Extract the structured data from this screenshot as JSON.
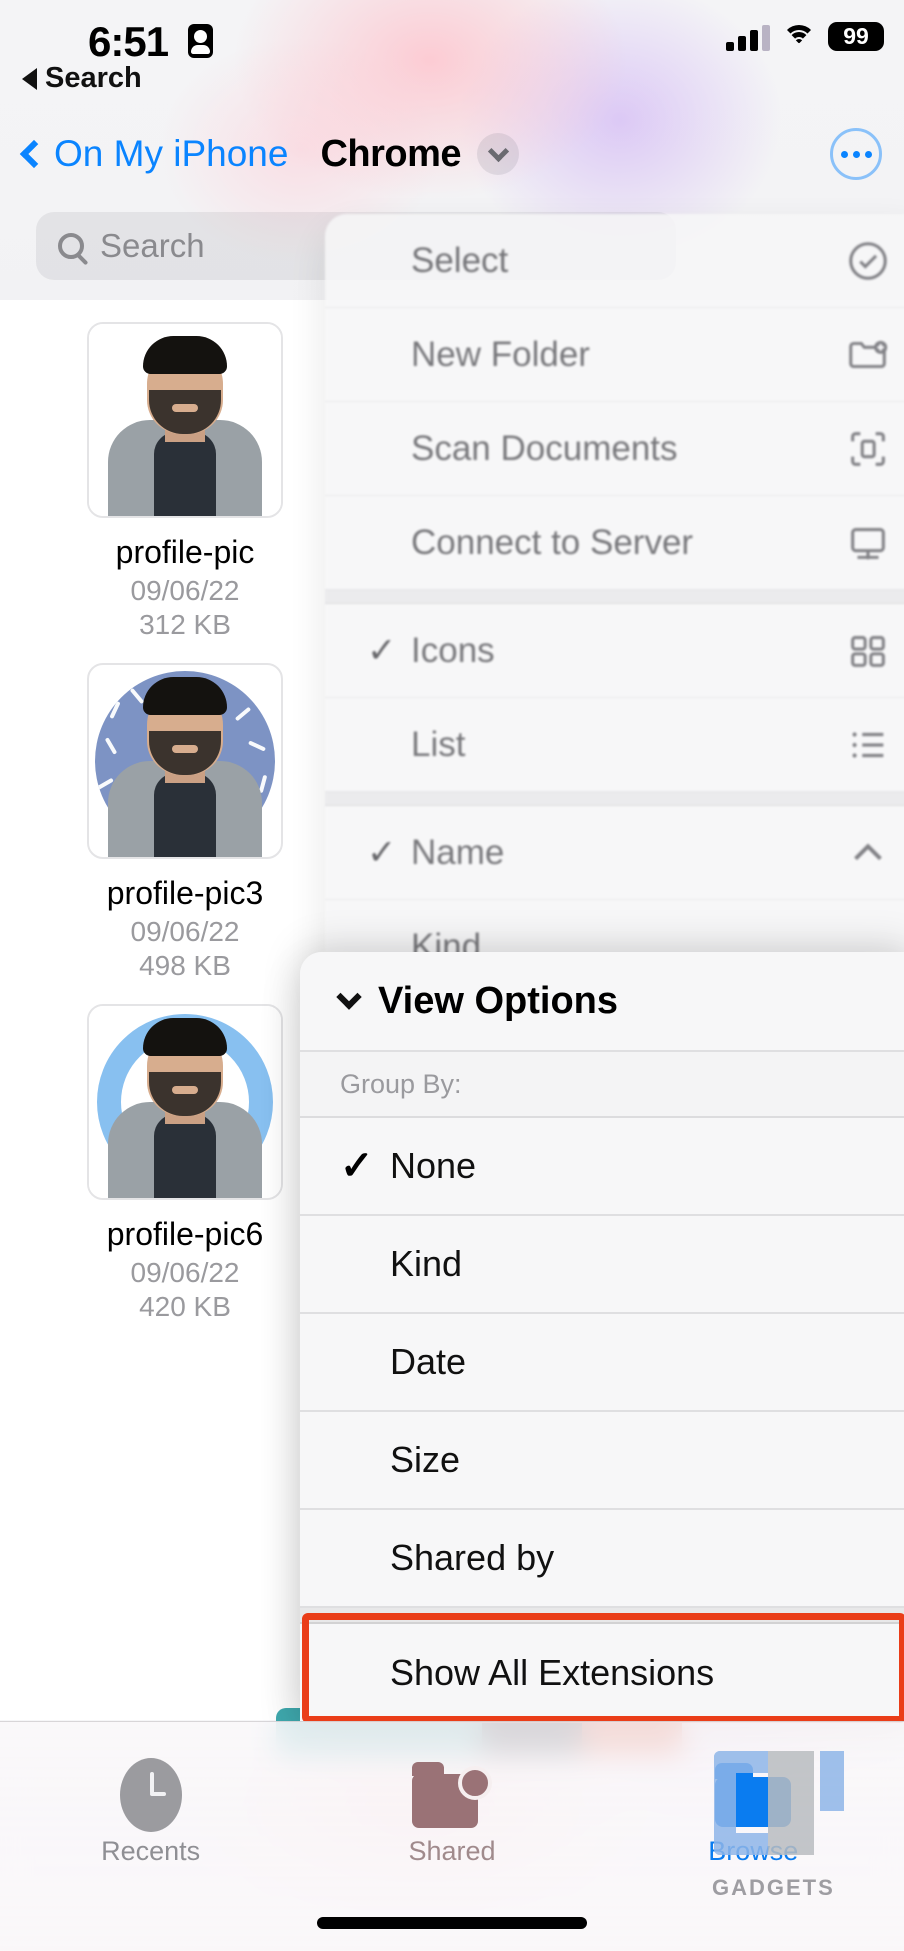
{
  "status_bar": {
    "time": "6:51",
    "recording_icon": "person-badge-icon",
    "back_label": "Search",
    "signal_icon": "cellular-bars-icon",
    "wifi_icon": "wifi-icon",
    "battery_level": "99"
  },
  "nav_bar": {
    "back_label": "On My iPhone",
    "title": "Chrome",
    "title_chevron_icon": "chevron-down-icon",
    "more_icon": "ellipsis-circle-icon"
  },
  "search": {
    "placeholder": "Search",
    "icon": "search-icon"
  },
  "files": [
    {
      "name": "profile-pic",
      "date": "09/06/22",
      "size": "312 KB",
      "thumb": "plain"
    },
    {
      "name": "profile-pic3",
      "date": "09/06/22",
      "size": "498 KB",
      "thumb": "dotted"
    },
    {
      "name": "profile-pic6",
      "date": "09/06/22",
      "size": "420 KB",
      "thumb": "ring"
    }
  ],
  "background_menu": {
    "groups": [
      {
        "items": [
          {
            "label": "Select",
            "icon": "checkmark-circle-icon",
            "checked": false
          },
          {
            "label": "New Folder",
            "icon": "folder-plus-icon",
            "checked": false
          },
          {
            "label": "Scan Documents",
            "icon": "scan-document-icon",
            "checked": false
          },
          {
            "label": "Connect to Server",
            "icon": "display-icon",
            "checked": false
          }
        ]
      },
      {
        "items": [
          {
            "label": "Icons",
            "icon": "grid-icon",
            "checked": true
          },
          {
            "label": "List",
            "icon": "list-icon",
            "checked": false
          }
        ]
      },
      {
        "items": [
          {
            "label": "Name",
            "icon": "chevron-up-icon",
            "checked": true
          },
          {
            "label": "Kind",
            "icon": "",
            "checked": false
          }
        ]
      }
    ]
  },
  "view_options": {
    "title": "View Options",
    "collapse_icon": "chevron-down-icon",
    "group_by_label": "Group By:",
    "options": [
      {
        "label": "None",
        "checked": true
      },
      {
        "label": "Kind",
        "checked": false
      },
      {
        "label": "Date",
        "checked": false
      },
      {
        "label": "Size",
        "checked": false
      },
      {
        "label": "Shared by",
        "checked": false
      }
    ],
    "extra": {
      "label": "Show All Extensions",
      "highlighted": true
    },
    "highlight_color": "#ea3d18"
  },
  "tab_bar": {
    "tabs": [
      {
        "label": "Recents",
        "icon": "clock-icon",
        "active": false
      },
      {
        "label": "Shared",
        "icon": "folder-person-icon",
        "active": false
      },
      {
        "label": "Browse",
        "icon": "folder-icon",
        "active": true
      }
    ],
    "active_color": "#0a7cf0"
  },
  "watermark": {
    "text": "GADGETS"
  }
}
